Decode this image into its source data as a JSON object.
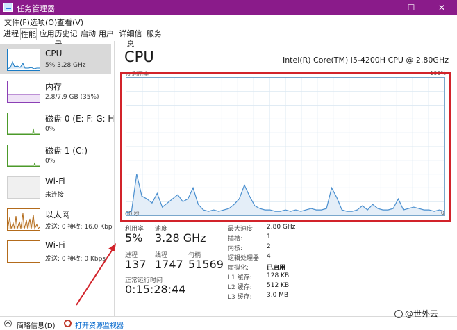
{
  "window": {
    "title": "任务管理器",
    "controls": {
      "minimize": "—",
      "maximize": "☐",
      "close": "✕"
    }
  },
  "menu": {
    "file": "文件(F)",
    "options": "选项(O)",
    "view": "查看(V)"
  },
  "tabs": [
    "进程",
    "性能",
    "应用历史记录",
    "启动",
    "用户",
    "详细信息",
    "服务"
  ],
  "active_tab": "性能",
  "sidebar": {
    "items": [
      {
        "name": "CPU",
        "sub": "5%  3.28 GHz",
        "color": "#1a7bc4"
      },
      {
        "name": "内存",
        "sub": "2.8/7.9 GB (35%)",
        "color": "#8b3fb5"
      },
      {
        "name": "磁盘 0 (E: F: G: H",
        "sub": "0%",
        "color": "#4c9a2a"
      },
      {
        "name": "磁盘 1 (C:)",
        "sub": "0%",
        "color": "#4c9a2a"
      },
      {
        "name": "Wi-Fi",
        "sub": "未连接",
        "color": "#8c8c8c"
      },
      {
        "name": "以太网",
        "sub": "发送: 0 接收: 16.0 Kbp",
        "color": "#b36b1b"
      },
      {
        "name": "Wi-Fi",
        "sub": "发送: 0 接收: 0 Kbps",
        "color": "#b36b1b"
      }
    ]
  },
  "cpu": {
    "title": "CPU",
    "model": "Intel(R) Core(TM) i5-4200H CPU @ 2.80GHz",
    "utilization_axis_label": "% 利用率",
    "axis_max": "100%",
    "time_left": "60 秒",
    "time_right": "0",
    "usage_history_percent": [
      2,
      3,
      30,
      14,
      12,
      9,
      16,
      6,
      9,
      12,
      15,
      10,
      12,
      20,
      8,
      4,
      3,
      4,
      3,
      4,
      5,
      8,
      12,
      22,
      14,
      7,
      5,
      4,
      4,
      3,
      3,
      4,
      3,
      4,
      3,
      4,
      5,
      4,
      4,
      5,
      20,
      13,
      4,
      3,
      3,
      4,
      7,
      4,
      8,
      5,
      4,
      4,
      5,
      12,
      4,
      5,
      6,
      5,
      4,
      4,
      3,
      4,
      3
    ],
    "utilization_label": "利用率",
    "utilization": "5%",
    "speed_label": "速度",
    "speed": "3.28 GHz",
    "processes_label": "进程",
    "processes": "137",
    "threads_label": "线程",
    "threads": "1747",
    "handles_label": "句柄",
    "handles": "51569",
    "uptime_label": "正常运行时间",
    "uptime": "0:15:28:44",
    "info": [
      {
        "label": "最大速度:",
        "value": "2.80 GHz"
      },
      {
        "label": "插槽:",
        "value": "1"
      },
      {
        "label": "内核:",
        "value": "2"
      },
      {
        "label": "逻辑处理器:",
        "value": "4"
      },
      {
        "label": "虚拟化:",
        "value": "已启用"
      },
      {
        "label": "L1 缓存:",
        "value": "128 KB"
      },
      {
        "label": "L2 缓存:",
        "value": "512 KB"
      },
      {
        "label": "L3 缓存:",
        "value": "3.0 MB"
      }
    ]
  },
  "footer": {
    "fewer_details": "简略信息(D)",
    "open_resource_monitor": "打开资源监视器"
  },
  "watermark": "@世外云",
  "colors": {
    "titlebar": "#8a1b8a",
    "graph_line": "#4a8fcf",
    "highlight": "#d2232a"
  }
}
